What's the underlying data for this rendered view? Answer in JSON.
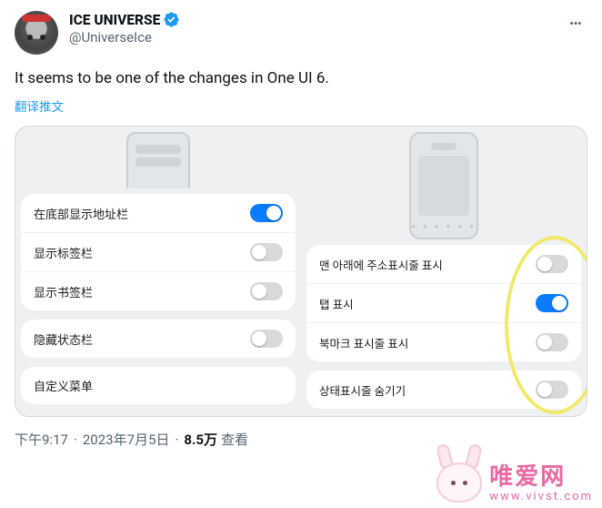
{
  "header": {
    "display_name": "ICE UNIVERSE",
    "handle": "@UniverseIce",
    "more_label": "…"
  },
  "tweet": {
    "text": "It seems to be one of the changes in One UI 6.",
    "translate_label": "翻译推文"
  },
  "panels": {
    "left": {
      "group1": [
        {
          "label": "在底部显示地址栏",
          "on": true
        },
        {
          "label": "显示标签栏",
          "on": false
        },
        {
          "label": "显示书签栏",
          "on": false
        }
      ],
      "group2": [
        {
          "label": "隐藏状态栏",
          "on": false
        }
      ],
      "group3": [
        {
          "label": "自定义菜单",
          "on": null
        }
      ]
    },
    "right": {
      "group1": [
        {
          "label": "맨 아래에 주소표시줄 표시",
          "on": false
        },
        {
          "label": "탭 표시",
          "on": true
        },
        {
          "label": "북마크 표시줄 표시",
          "on": false
        }
      ],
      "group2": [
        {
          "label": "상태표시줄 숨기기",
          "on": false
        }
      ]
    }
  },
  "meta": {
    "time": "下午9:17",
    "date": "2023年7月5日",
    "views_value": "8.5万",
    "views_label": "查看"
  },
  "watermark": {
    "text_cn": "唯爱网",
    "url": "www.vivst.com"
  }
}
